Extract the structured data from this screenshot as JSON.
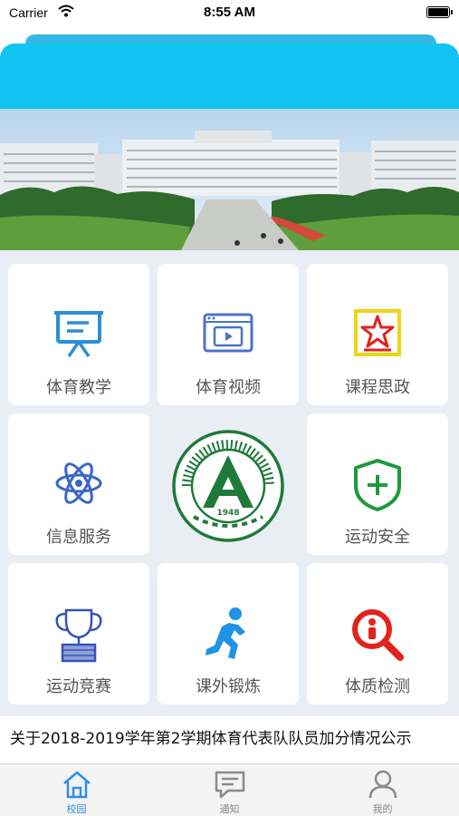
{
  "status_bar": {
    "carrier": "Carrier",
    "time": "8:55 AM"
  },
  "grid": {
    "tiles": [
      {
        "label": "体育教学",
        "icon": "presentation-board-icon"
      },
      {
        "label": "体育视频",
        "icon": "video-play-icon"
      },
      {
        "label": "课程思政",
        "icon": "red-star-flag-icon"
      },
      {
        "label": "信息服务",
        "icon": "atom-icon"
      },
      {
        "label": "运动安全",
        "icon": "shield-plus-icon"
      },
      {
        "label": "运动竞赛",
        "icon": "trophy-icon"
      },
      {
        "label": "课外锻炼",
        "icon": "running-person-icon"
      },
      {
        "label": "体质检测",
        "icon": "search-person-icon"
      }
    ],
    "logo": {
      "top_text": "NORTHEAST AGRICULTURAL UNIVERSITY",
      "year": "1948"
    }
  },
  "news": {
    "text": "关于2018-2019学年第2学期体育代表队队员加分情况公示"
  },
  "tab_bar": {
    "tabs": [
      {
        "label": "校园",
        "icon": "home-icon",
        "active": true
      },
      {
        "label": "通知",
        "icon": "message-icon",
        "active": false
      },
      {
        "label": "我的",
        "icon": "person-icon",
        "active": false
      }
    ]
  },
  "colors": {
    "header": "#12c4f1",
    "accent": "#2e8ee8",
    "logo_green": "#1f7a3a",
    "star_red": "#e0231b",
    "grid_bg": "#e9eef4"
  }
}
